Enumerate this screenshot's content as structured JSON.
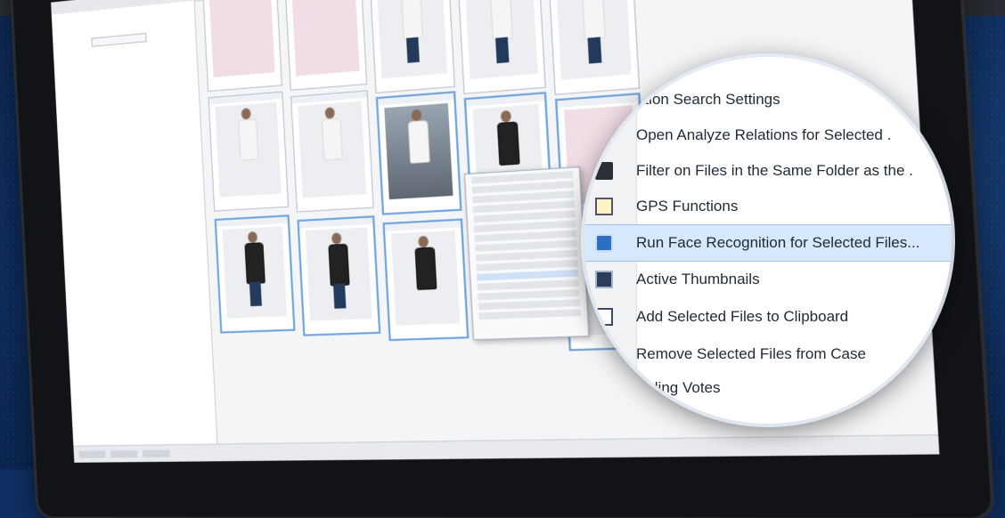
{
  "context_menu": {
    "items": [
      {
        "label": "ation Search Settings",
        "icon": ""
      },
      {
        "label": "Open Analyze Relations for Selected .",
        "icon": ""
      },
      {
        "label": "Filter on Files in the Same Folder as the .",
        "icon": "folder-icon"
      },
      {
        "label": "GPS Functions",
        "icon": "map-icon"
      },
      {
        "label": "Run Face Recognition for Selected Files...",
        "icon": "face-recognition-icon",
        "highlighted": true
      },
      {
        "label": "Active Thumbnails",
        "icon": "thumbnails-icon"
      },
      {
        "label": "Add Selected Files to Clipboard",
        "icon": "clipboard-icon"
      },
      {
        "label": "Remove Selected Files from Case",
        "icon": ""
      },
      {
        "label": "rriding Votes",
        "icon": ""
      }
    ]
  },
  "colors": {
    "background": "#0f2f63",
    "highlight": "#d6e8fb",
    "menu_text": "#1f2a36"
  }
}
